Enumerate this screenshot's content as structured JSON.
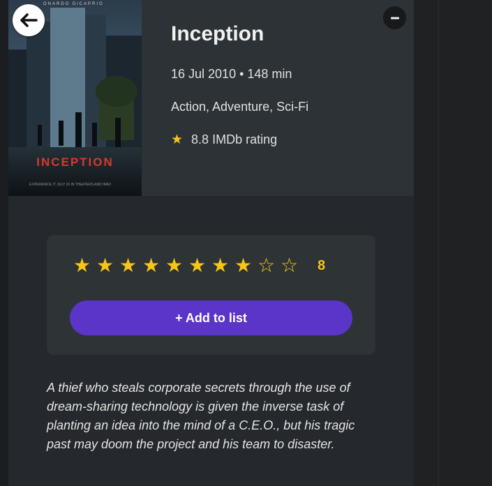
{
  "movie": {
    "title": "Inception",
    "meta": "16 Jul 2010 • 148 min",
    "genres": "Action, Adventure, Sci-Fi",
    "imdb": "8.8 IMDb rating",
    "plot": "A thief who steals corporate secrets through the use of dream-sharing technology is given the inverse task of planting an idea into the mind of a C.E.O., but his tragic past may doom the project and his team to disaster."
  },
  "poster": {
    "top_text": "ONARDO DiCAPRIO",
    "title": "INCEPTION",
    "fine_print": "EXPERIENCE IT JULY 16 IN THEATERS AND IMAX"
  },
  "rating": {
    "max": 10,
    "value": 8,
    "value_label": "8"
  },
  "actions": {
    "add_to_list": "+ Add to list"
  },
  "colors": {
    "accent": "#5a35c8",
    "star": "#f5c518"
  }
}
